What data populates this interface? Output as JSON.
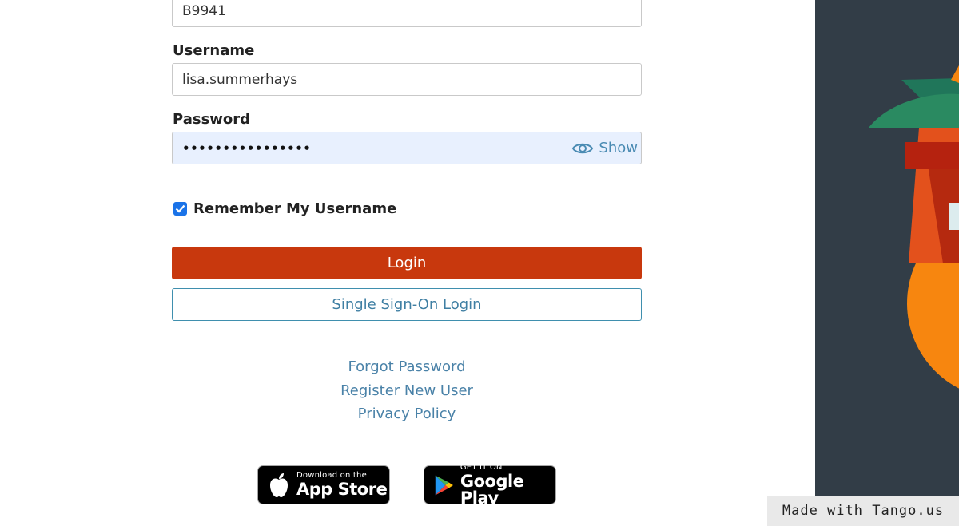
{
  "form": {
    "top_field_value": "B9941",
    "username_label": "Username",
    "username_value": "lisa.summerhays",
    "password_label": "Password",
    "password_value": "••••••••••••••••",
    "show_label": "Show",
    "remember_label": "Remember My Username",
    "remember_checked": true,
    "login_label": "Login",
    "sso_label": "Single Sign-On Login"
  },
  "links": {
    "forgot": "Forgot Password",
    "register": "Register New User",
    "privacy": "Privacy Policy"
  },
  "stores": {
    "apple_small": "Download on the",
    "apple_big": "App Store",
    "google_small": "GET IT ON",
    "google_big": "Google Play"
  },
  "watermark": "Made with Tango.us",
  "colors": {
    "login_bg": "#c8380d",
    "link": "#4a82a8",
    "panel_bg": "#323d47"
  }
}
